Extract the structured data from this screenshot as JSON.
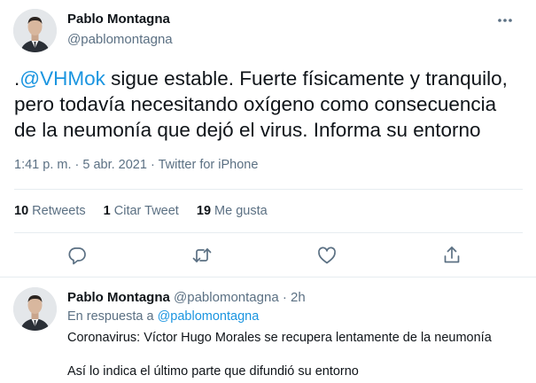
{
  "main_tweet": {
    "author_name": "Pablo Montagna",
    "author_handle": "@pablomontagna",
    "text_prefix": ".",
    "mention": "@VHMok",
    "text_line1_rest": " sigue estable. Fuerte físicamente y tranquilo,",
    "text_line2": "pero todavía necesitando oxígeno como consecuencia",
    "text_line3": "de la neumonía que dejó el virus. Informa su entorno",
    "time": "1:41 p. m.",
    "date": "5 abr. 2021",
    "source": "Twitter for iPhone",
    "stats": {
      "retweets_count": "10",
      "retweets_label": "Retweets",
      "quotes_count": "1",
      "quotes_label": "Citar Tweet",
      "likes_count": "19",
      "likes_label": "Me gusta"
    }
  },
  "reply_tweet": {
    "author_name": "Pablo Montagna",
    "author_handle": "@pablomontagna",
    "age": "2h",
    "reply_to_label": "En respuesta a",
    "reply_to_handle": "@pablomontagna",
    "line1": "Coronavirus: Víctor Hugo Morales se recupera lentamente de la neumonía",
    "line2": "Así lo indica el último parte que difundió su entorno"
  },
  "icons": {
    "more": "more-icon",
    "reply": "reply-icon",
    "retweet": "retweet-icon",
    "like": "heart-icon",
    "share": "share-icon"
  },
  "colors": {
    "accent": "#1b95e0",
    "secondary_text": "#5b7083",
    "primary_text": "#0f1419",
    "divider": "#e6ecf0"
  }
}
